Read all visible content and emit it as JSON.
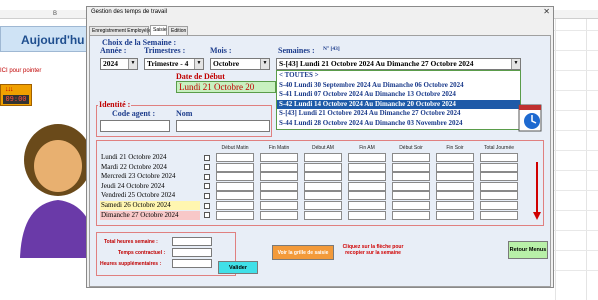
{
  "sheet": {
    "col_b": "B",
    "col_j": "J",
    "banner": "Aujourd'hu",
    "click_hint": "ICI pour pointer",
    "clock_arrows": "↓↓↓",
    "clock_time": "09:00"
  },
  "window": {
    "title": "Gestion des temps de travail",
    "close": "✕",
    "tabs": [
      "Enregistrement Employé(e)",
      "Saisie",
      "Edition"
    ]
  },
  "week": {
    "heading": "Choix de la  Semaine :",
    "annee_label": "Année :",
    "trimestre_label": "Trimestres :",
    "mois_label": "Mois :",
    "semaines_label": "Semaines :",
    "semaine_num": "N° [43]",
    "annee_value": "2024",
    "trimestre_value": "Trimestre - 4",
    "mois_value": "Octobre",
    "semaine_value": "S-[43] Lundi 21 Octobre 2024 Au Dimanche 27 Octobre 2024",
    "date_debut_label": "Date de Début",
    "date_debut_value": "Lundi 21 Octobre 20",
    "options": [
      "< TOUTES >",
      "S-40 Lundi 30 Septembre 2024 Au Dimanche 06 Octobre 2024",
      "S-41 Lundi 07 Octobre 2024 Au Dimanche 13 Octobre 2024",
      "S-42 Lundi 14 Octobre 2024 Au Dimanche 20 Octobre 2024",
      "S-[43] Lundi 21 Octobre 2024 Au Dimanche 27 Octobre 2024",
      "S-44 Lundi 28 Octobre 2024 Au Dimanche 03 Novembre 2024"
    ],
    "selected_index": 3
  },
  "identite": {
    "title": "Identité :",
    "code_label": "Code agent :",
    "nom_label": "Nom"
  },
  "schedule": {
    "columns": [
      "Début Matin",
      "Fin Matin",
      "Début AM",
      "Fin AM",
      "Début Soir",
      "Fin Soir",
      "Total Journée"
    ],
    "days": [
      "Lundi 21 Octobre 2024",
      "Mardi 22 Octobre 2024",
      "Mercredi 23 Octobre 2024",
      "Jeudi 24 Octobre 2024",
      "Vendredi 25 Octobre 2024",
      "Samedi 26 Octobre 2024",
      "Dimanche 27 Octobre 2024"
    ],
    "day_colors": [
      "#e8eef7",
      "#e8eef7",
      "#e8eef7",
      "#e8eef7",
      "#e8eef7",
      "#fff6b0",
      "#f8c8c8"
    ]
  },
  "totals": {
    "total_semaine": "Total heures semaine :",
    "temps_contractuel": "Temps contractuel :",
    "heures_sup": "Heures supplémentaires :",
    "valider": "Valider"
  },
  "actions": {
    "grille": "Voir la grille de saisie",
    "hint": "Cliquez sur la flèche pour recopier sur la semaine",
    "retour": "Retour Menus"
  },
  "colors": {
    "accent_blue": "#1c3c8c",
    "accent_red": "#c00000",
    "selected_row": "#1e5aa8",
    "valider_btn": "#40e0e8",
    "grille_btn": "#f39a3a",
    "retour_btn": "#b8f0a8"
  }
}
